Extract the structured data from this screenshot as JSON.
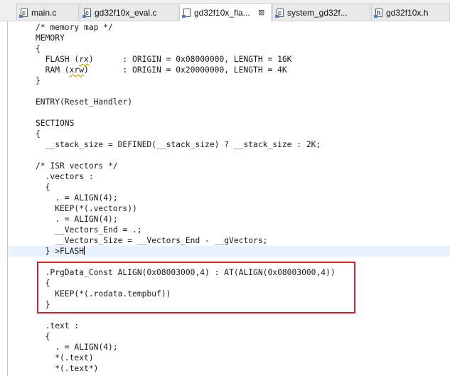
{
  "tabs": [
    {
      "label": "main.c",
      "letter": "c"
    },
    {
      "label": "gd32f10x_eval.c",
      "letter": "c"
    },
    {
      "label": "gd32f10x_fla...",
      "letter": "",
      "active": true
    },
    {
      "label": "system_gd32f...",
      "letter": "c"
    },
    {
      "label": "gd32f10x.h",
      "letter": "h"
    }
  ],
  "close_glyph": "⊠",
  "code": {
    "lines": [
      "/* memory map */",
      "MEMORY",
      "{",
      "  FLASH (rx)      : ORIGIN = 0x08000000, LENGTH = 16K",
      "  RAM (xrw)       : ORIGIN = 0x20000000, LENGTH = 4K",
      "}",
      "",
      "ENTRY(Reset_Handler)",
      "",
      "SECTIONS",
      "{",
      "  __stack_size = DEFINED(__stack_size) ? __stack_size : 2K;",
      "",
      "/* ISR vectors */",
      "  .vectors :",
      "  {",
      "    . = ALIGN(4);",
      "    KEEP(*(.vectors))",
      "    . = ALIGN(4);",
      "    __Vectors_End = .;",
      "    __Vectors_Size = __Vectors_End - __gVectors;",
      "  } >FLASH",
      "",
      "  .PrgData_Const ALIGN(0x08003000,4) : AT(ALIGN(0x08003000,4))",
      "  {",
      "    KEEP(*(.rodata.tempbuf))",
      "  }",
      "",
      "  .text :",
      "  {",
      "    . = ALIGN(4);",
      "    *(.text)",
      "    *(.text*)"
    ]
  },
  "colors": {
    "current_line": "#e8f2fe",
    "highlight_border": "#d8202a"
  }
}
